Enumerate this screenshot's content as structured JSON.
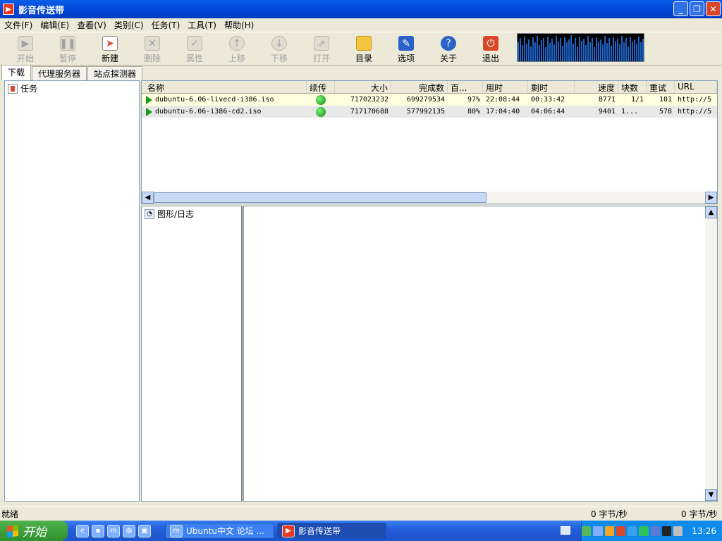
{
  "window": {
    "title": "影音传送带",
    "buttons": {
      "minimize": "_",
      "restore": "❐",
      "close": "✕"
    }
  },
  "menu": [
    "文件(F)",
    "编辑(E)",
    "查看(V)",
    "类别(C)",
    "任务(T)",
    "工具(T)",
    "帮助(H)"
  ],
  "toolbar": {
    "start": "开始",
    "pause": "暂停",
    "new": "新建",
    "delete": "删除",
    "properties": "属性",
    "up": "上移",
    "down": "下移",
    "open": "打开",
    "folder": "目录",
    "options": "选项",
    "about": "关于",
    "exit": "退出"
  },
  "tabs": [
    "下载",
    "代理服务器",
    "站点探测器"
  ],
  "tree": {
    "root": "任务"
  },
  "list": {
    "headers": [
      "名称",
      "续传",
      "大小",
      "完成数",
      "百...",
      "用时",
      "剩时",
      "速度",
      "块数",
      "重试",
      "URL"
    ],
    "rows": [
      {
        "name": "dubuntu-6.06-livecd-i386.iso",
        "size": "717023232",
        "done": "699279534",
        "pct": "97%",
        "used": "22:08:44",
        "left": "00:33:42",
        "speed": "8771",
        "blocks": "1/1",
        "retry": "101",
        "url": "http://5"
      },
      {
        "name": "dubuntu-6.06-i386-cd2.iso",
        "size": "717170688",
        "done": "577992135",
        "pct": "80%",
        "used": "17:04:40",
        "left": "04:06:44",
        "speed": "9401",
        "blocks": "1...",
        "retry": "578",
        "url": "http://5"
      }
    ]
  },
  "graph_tab": {
    "label": "图形/日志"
  },
  "status": {
    "text": "就绪",
    "speed1": "0 字节/秒",
    "speed2": "0 字节/秒"
  },
  "taskbar": {
    "start": "开始",
    "tasks": [
      {
        "label": "Ubuntu中文 论坛 ..."
      },
      {
        "label": "影音传送带"
      }
    ],
    "clock": "13:26"
  }
}
